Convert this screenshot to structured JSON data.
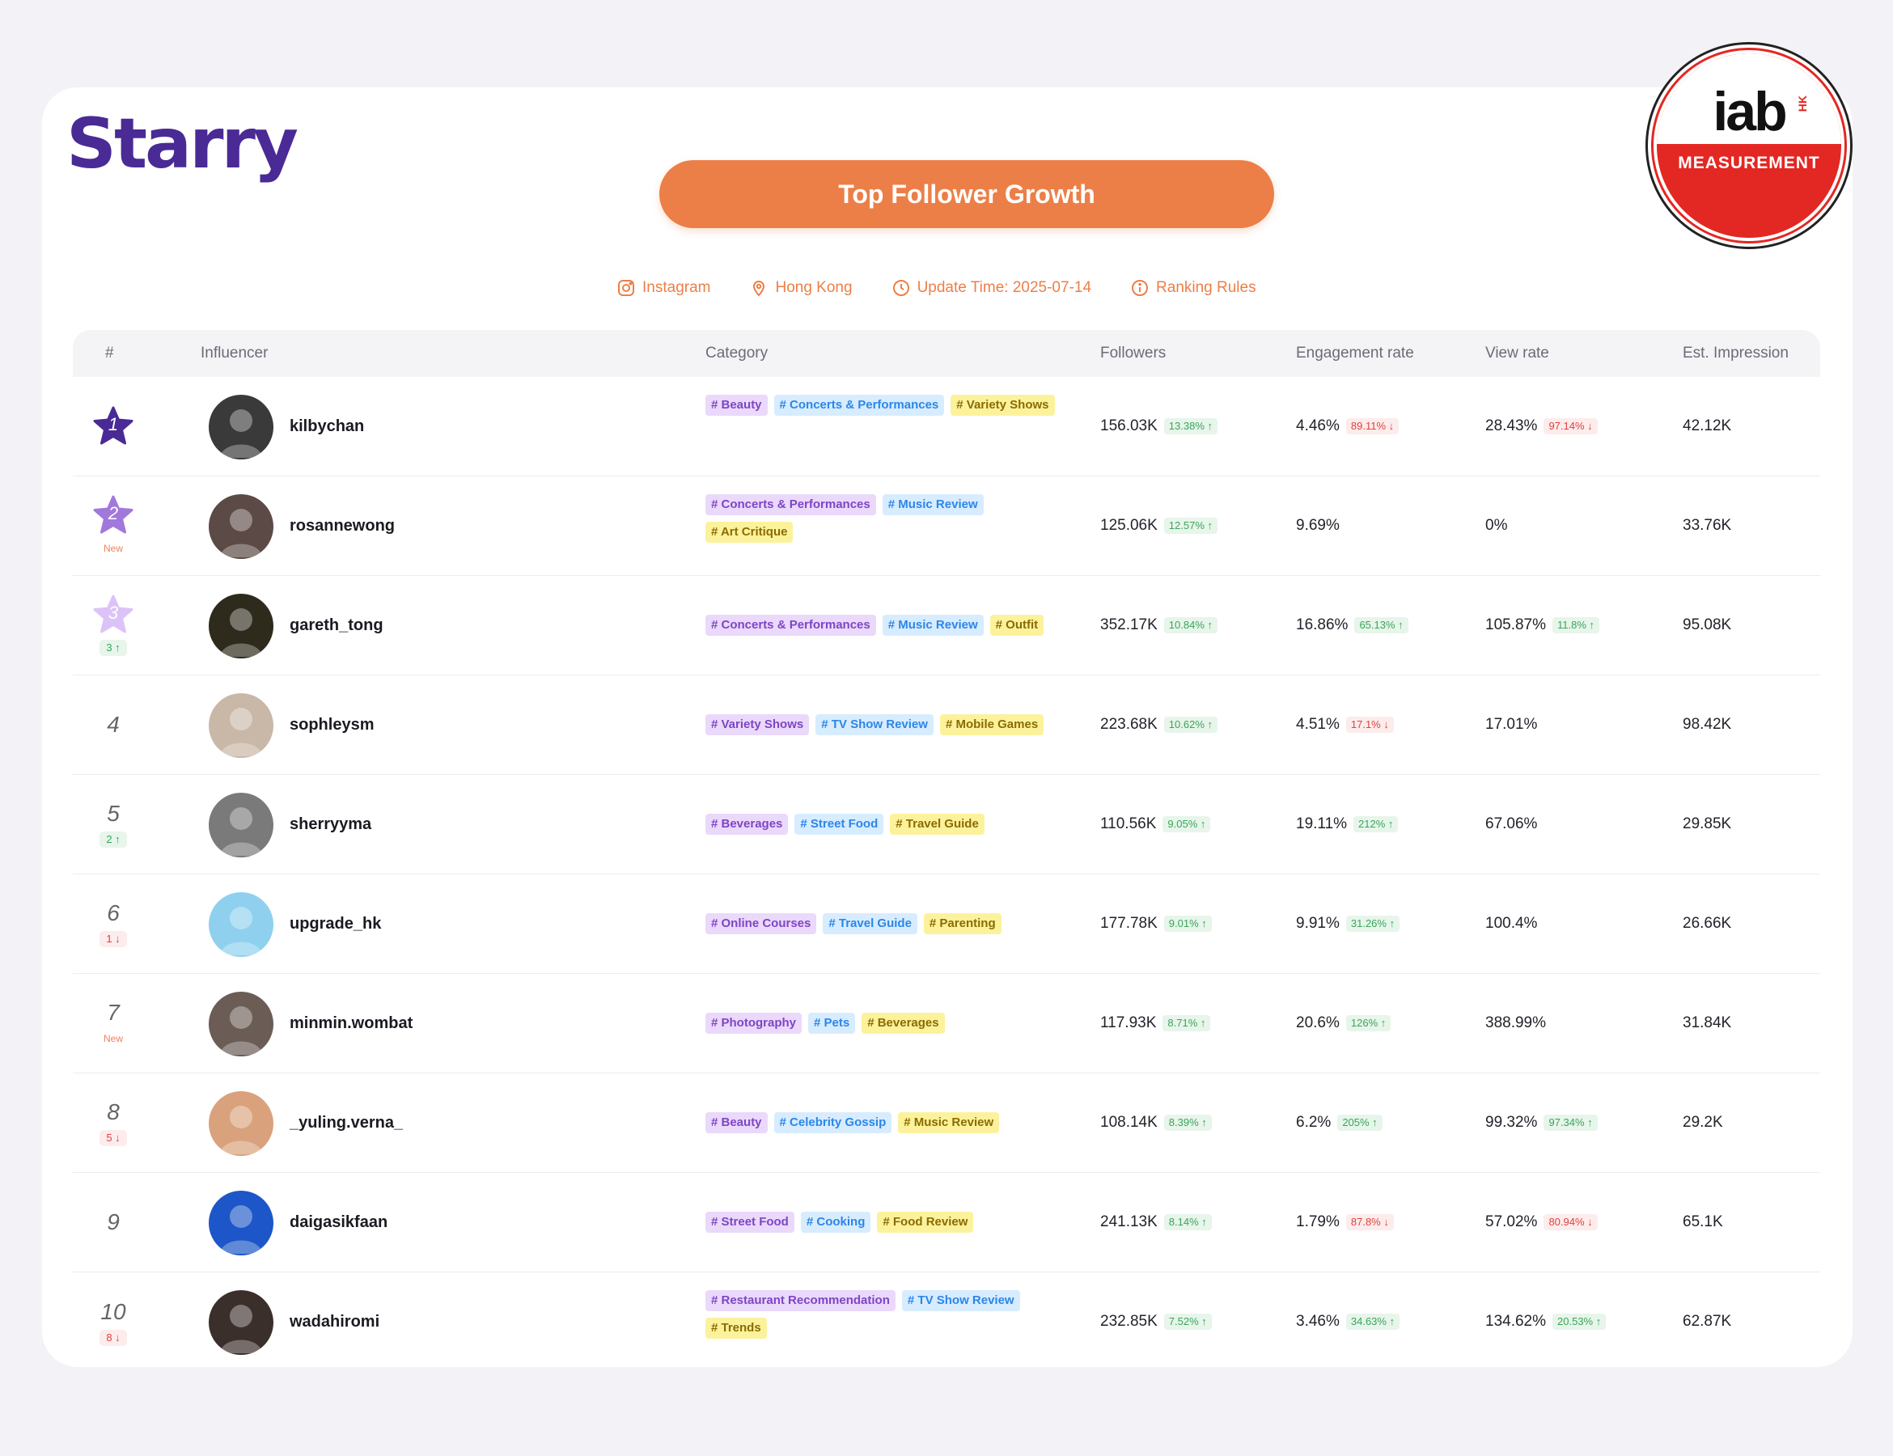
{
  "brand": {
    "logo_text": "Starry"
  },
  "title": "Top Follower Growth",
  "meta": {
    "platform": "Instagram",
    "region": "Hong Kong",
    "update_time": "Update Time: 2025-07-14",
    "rules": "Ranking Rules"
  },
  "iab_badge": {
    "word": "iab",
    "region": "HK",
    "label": "MEASUREMENT"
  },
  "colors": {
    "accent": "#ec7f47",
    "brand": "#4a2a95",
    "up": "#3aa55a",
    "down": "#e0413d"
  },
  "table": {
    "headers": {
      "rank": "#",
      "influencer": "Influencer",
      "category": "Category",
      "followers": "Followers",
      "engagement": "Engagement rate",
      "view_rate": "View rate",
      "impression": "Est. Impression"
    },
    "rows": [
      {
        "rank": "1",
        "badge": "",
        "handle": "kilbychan",
        "tags": [
          {
            "text": "# Beauty",
            "color": "purple"
          },
          {
            "text": "# Concerts & Performances",
            "color": "blue"
          },
          {
            "text": "# Variety Shows",
            "color": "yellow"
          }
        ],
        "followers": "156.03K",
        "followers_chg": "13.38% ↑",
        "engagement": "4.46%",
        "engagement_chg": "89.11% ↓",
        "view_rate": "28.43%",
        "view_rate_chg": "97.14% ↓",
        "impression": "42.12K"
      },
      {
        "rank": "2",
        "badge": "New",
        "handle": "rosannewong",
        "tags": [
          {
            "text": "# Concerts & Performances",
            "color": "purple"
          },
          {
            "text": "# Music Review",
            "color": "blue"
          },
          {
            "text": "# Art Critique",
            "color": "yellow"
          }
        ],
        "followers": "125.06K",
        "followers_chg": "12.57% ↑",
        "engagement": "9.69%",
        "engagement_chg": "",
        "view_rate": "0%",
        "view_rate_chg": "",
        "impression": "33.76K"
      },
      {
        "rank": "3",
        "badge": "3 ↑",
        "handle": "gareth_tong",
        "tags": [
          {
            "text": "# Concerts & Performances",
            "color": "purple"
          },
          {
            "text": "# Music Review",
            "color": "blue"
          },
          {
            "text": "# Outfit",
            "color": "yellow"
          }
        ],
        "followers": "352.17K",
        "followers_chg": "10.84% ↑",
        "engagement": "16.86%",
        "engagement_chg": "65.13% ↑",
        "view_rate": "105.87%",
        "view_rate_chg": "11.8% ↑",
        "impression": "95.08K"
      },
      {
        "rank": "4",
        "badge": "",
        "handle": "sophleysm",
        "tags": [
          {
            "text": "# Variety Shows",
            "color": "purple"
          },
          {
            "text": "# TV Show Review",
            "color": "blue"
          },
          {
            "text": "# Mobile Games",
            "color": "yellow"
          }
        ],
        "followers": "223.68K",
        "followers_chg": "10.62% ↑",
        "engagement": "4.51%",
        "engagement_chg": "17.1% ↓",
        "view_rate": "17.01%",
        "view_rate_chg": "",
        "impression": "98.42K"
      },
      {
        "rank": "5",
        "badge": "2 ↑",
        "handle": "sherryyma",
        "tags": [
          {
            "text": "# Beverages",
            "color": "purple"
          },
          {
            "text": "# Street Food",
            "color": "blue"
          },
          {
            "text": "# Travel Guide",
            "color": "yellow"
          }
        ],
        "followers": "110.56K",
        "followers_chg": "9.05% ↑",
        "engagement": "19.11%",
        "engagement_chg": "212% ↑",
        "view_rate": "67.06%",
        "view_rate_chg": "",
        "impression": "29.85K"
      },
      {
        "rank": "6",
        "badge": "1 ↓",
        "handle": "upgrade_hk",
        "tags": [
          {
            "text": "# Online Courses",
            "color": "purple"
          },
          {
            "text": "# Travel Guide",
            "color": "blue"
          },
          {
            "text": "# Parenting",
            "color": "yellow"
          }
        ],
        "followers": "177.78K",
        "followers_chg": "9.01% ↑",
        "engagement": "9.91%",
        "engagement_chg": "31.26% ↑",
        "view_rate": "100.4%",
        "view_rate_chg": "",
        "impression": "26.66K"
      },
      {
        "rank": "7",
        "badge": "New",
        "handle": "minmin.wombat",
        "tags": [
          {
            "text": "# Photography",
            "color": "purple"
          },
          {
            "text": "# Pets",
            "color": "blue"
          },
          {
            "text": "# Beverages",
            "color": "yellow"
          }
        ],
        "followers": "117.93K",
        "followers_chg": "8.71% ↑",
        "engagement": "20.6%",
        "engagement_chg": "126% ↑",
        "view_rate": "388.99%",
        "view_rate_chg": "",
        "impression": "31.84K"
      },
      {
        "rank": "8",
        "badge": "5 ↓",
        "handle": "_yuling.verna_",
        "tags": [
          {
            "text": "# Beauty",
            "color": "purple"
          },
          {
            "text": "# Celebrity Gossip",
            "color": "blue"
          },
          {
            "text": "# Music Review",
            "color": "yellow"
          }
        ],
        "followers": "108.14K",
        "followers_chg": "8.39% ↑",
        "engagement": "6.2%",
        "engagement_chg": "205% ↑",
        "view_rate": "99.32%",
        "view_rate_chg": "97.34% ↑",
        "impression": "29.2K"
      },
      {
        "rank": "9",
        "badge": "",
        "handle": "daigasikfaan",
        "tags": [
          {
            "text": "# Street Food",
            "color": "purple"
          },
          {
            "text": "# Cooking",
            "color": "blue"
          },
          {
            "text": "# Food Review",
            "color": "yellow"
          }
        ],
        "followers": "241.13K",
        "followers_chg": "8.14% ↑",
        "engagement": "1.79%",
        "engagement_chg": "87.8% ↓",
        "view_rate": "57.02%",
        "view_rate_chg": "80.94% ↓",
        "impression": "65.1K"
      },
      {
        "rank": "10",
        "badge": "8 ↓",
        "handle": "wadahiromi",
        "tags": [
          {
            "text": "# Restaurant Recommendation",
            "color": "purple"
          },
          {
            "text": "# TV Show Review",
            "color": "blue"
          },
          {
            "text": "# Trends",
            "color": "yellow"
          }
        ],
        "followers": "232.85K",
        "followers_chg": "7.52% ↑",
        "engagement": "3.46%",
        "engagement_chg": "34.63% ↑",
        "view_rate": "134.62%",
        "view_rate_chg": "20.53% ↑",
        "impression": "62.87K"
      }
    ]
  }
}
